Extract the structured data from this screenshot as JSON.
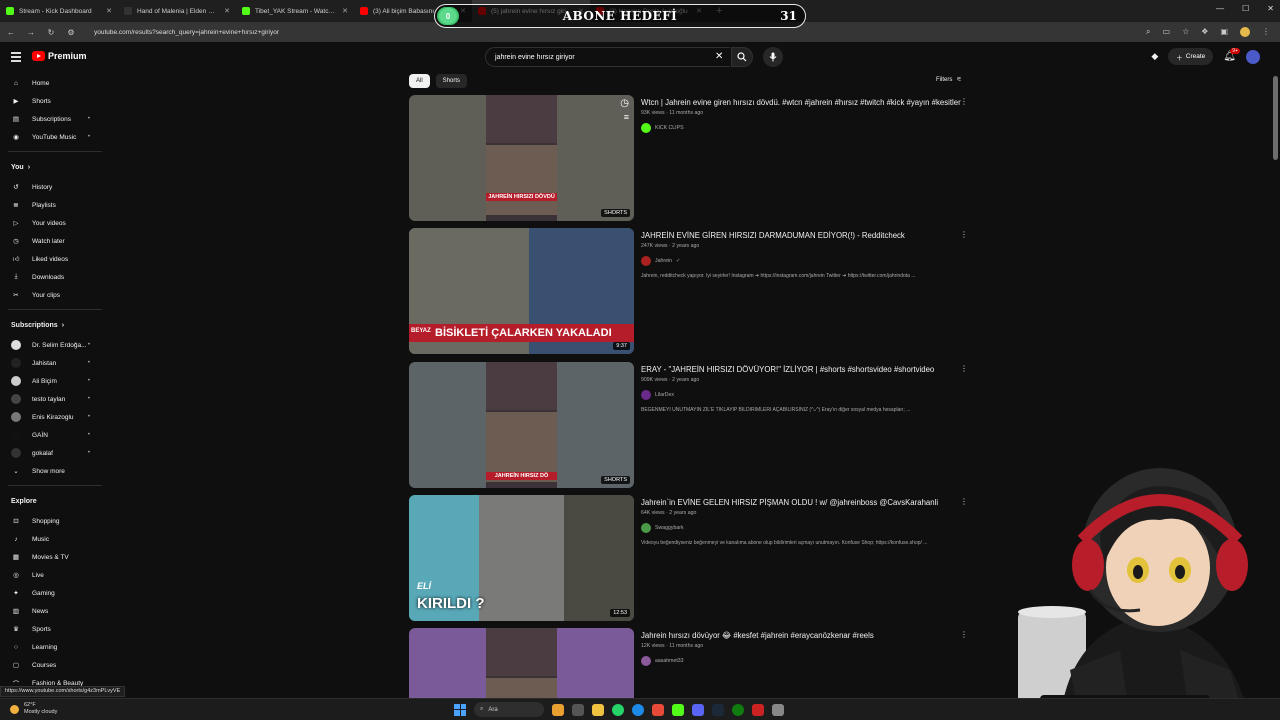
{
  "browser": {
    "tabs": [
      {
        "label": "Stream - Kick Dashboard",
        "color": "#53fc18"
      },
      {
        "label": "Hand of Malenia | Elden Ring W",
        "color": "#333333"
      },
      {
        "label": "Tibet_YAK Stream - Watch Live",
        "color": "#53fc18"
      },
      {
        "label": "(3) Ali biçim Babasını",
        "color": "#ff0000"
      },
      {
        "label": "(5) jahrein evine hırsız giriyor",
        "color": "#ff0000"
      },
      {
        "label": "(3) Hacının Deniz Avasoğlu",
        "color": "#ff0000"
      }
    ],
    "active_tab": 4,
    "url": "youtube.com/results?search_query=jahrein+evine+hırsız+giriyor"
  },
  "overlay": {
    "goal_title": "ABONE HEDEFİ",
    "goal_start": "0",
    "goal_target": "31",
    "goal_progress": 0.05
  },
  "header": {
    "logo_text": "Premium",
    "search_value": "jahrein evine hırsız giriyor",
    "create_label": "Create",
    "notif_count": "9+"
  },
  "sidebar": {
    "main": [
      {
        "label": "Home",
        "icon": "home-icon"
      },
      {
        "label": "Shorts",
        "icon": "shorts-icon"
      },
      {
        "label": "Subscriptions",
        "icon": "subscriptions-icon"
      },
      {
        "label": "YouTube Music",
        "icon": "music-icon"
      }
    ],
    "you_title": "You",
    "you": [
      {
        "label": "History",
        "icon": "history-icon"
      },
      {
        "label": "Playlists",
        "icon": "playlist-icon"
      },
      {
        "label": "Your videos",
        "icon": "video-icon"
      },
      {
        "label": "Watch later",
        "icon": "clock-icon"
      },
      {
        "label": "Liked videos",
        "icon": "like-icon"
      },
      {
        "label": "Downloads",
        "icon": "download-icon"
      },
      {
        "label": "Your clips",
        "icon": "scissors-icon"
      }
    ],
    "subs_title": "Subscriptions",
    "subs": [
      {
        "label": "Dr. Selim Erdoğa...",
        "color": "#dddddd"
      },
      {
        "label": "Jahistan",
        "color": "#222222"
      },
      {
        "label": "Ali Biçim",
        "color": "#cccccc"
      },
      {
        "label": "testo taylan",
        "color": "#444444"
      },
      {
        "label": "Enis Kirazoglu",
        "color": "#777777"
      },
      {
        "label": "GAİN",
        "color": "#111111"
      },
      {
        "label": "gokalaf",
        "color": "#333333"
      },
      {
        "label": "Show more",
        "color": ""
      }
    ],
    "explore_title": "Explore",
    "explore": [
      {
        "label": "Shopping",
        "icon": "bag-icon"
      },
      {
        "label": "Music",
        "icon": "music-note-icon"
      },
      {
        "label": "Movies & TV",
        "icon": "film-icon"
      },
      {
        "label": "Live",
        "icon": "live-icon"
      },
      {
        "label": "Gaming",
        "icon": "gamepad-icon"
      },
      {
        "label": "News",
        "icon": "news-icon"
      },
      {
        "label": "Sports",
        "icon": "trophy-icon"
      },
      {
        "label": "Learning",
        "icon": "bulb-icon"
      },
      {
        "label": "Courses",
        "icon": "courses-icon"
      },
      {
        "label": "Fashion & Beauty",
        "icon": "hanger-icon"
      }
    ]
  },
  "chips": [
    "All",
    "Shorts"
  ],
  "filters_label": "Filters",
  "results": [
    {
      "title": "Wtcn | Jahrein evine giren hırsızı dövdü. #wtcn #jahrein #hırsız #twitch #kick #yayın #kesitler",
      "meta": "93K views · 11 months ago",
      "channel": "KICK CLIPS",
      "channel_color": "#53fc18",
      "desc": "",
      "badge": "SHORTS",
      "thumb_caption": "JAHREİN HIRSIZI DÖVDÜ",
      "thumb_color": "#5f5f58"
    },
    {
      "title": "JAHREİN EVİNE GİREN HIRSIZI DARMADUMAN EDİYOR(!) - Redditcheck",
      "meta": "247K views · 2 years ago",
      "channel": "Jahrein",
      "channel_color": "#aa2222",
      "desc": "Jahrein, redditcheck yapıyor. İyi seyirler! Instagram ➜ https://instagram.com/jahrein Twitter ➜ https://twitter.com/jahrindotа ...",
      "badge": "9:37",
      "thumb_caption": "BİSİKLETİ ÇALARKEN YAKALADI",
      "thumb_tag": "BEYAZ",
      "thumb_color": "#5a5048"
    },
    {
      "title": "ERAY - \"JAHREİN HIRSIZI DÖVÜYOR!\" İZLİYOR | #shorts #shortsvideo #shortvideo",
      "meta": "909K views · 2 years ago",
      "channel": "LilarDex",
      "channel_color": "#6a2a8a",
      "desc": "BEĞENMEYİ UNUTMAYIN ZİL'E TIKLAYIP BİLDİRİMLERİ AÇABİLİRSİNİZ (^ᴗ^) Eray'ın diğer sosyal medya hesapları; ...",
      "badge": "SHORTS",
      "thumb_caption": "JAHREİN HIRSIZ DÖ",
      "thumb_color": "#5c6468"
    },
    {
      "title": "Jahrein`in EVİNE GELEN HIRSIZ PİŞMAN OLDU ! w/ @jahreinboss @CavsKarahanli",
      "meta": "64K views · 2 years ago",
      "channel": "Swaggybark",
      "channel_color": "#4a9a4a",
      "desc": "Videoyu beğendiyseniz beğenmeyi ve kanalıma abone olup bildirimleri açmayı unutmayın. Konfuse Shop; https://konfuse.shop/ ...",
      "badge": "12:53",
      "thumb_caption": "KIRILDI ?",
      "thumb_tag": "ELİ",
      "thumb_color": "#3aa3a0"
    },
    {
      "title": "Jahrein hırsızı dövüyor 😂 #kesfet #jahrein #eraycanözkenar #reels",
      "meta": "12K views · 11 months ago",
      "channel": "aasahmet33",
      "channel_color": "#8a5a9a",
      "desc": "",
      "badge": "",
      "thumb_caption": "",
      "thumb_color": "#7a5a98"
    }
  ],
  "status_url": "https://www.youtube.com/shorts/g4z3mPLvyVE",
  "taskbar": {
    "temp": "62°F",
    "weather": "Mostly cloudy",
    "search_label": "Ara"
  }
}
